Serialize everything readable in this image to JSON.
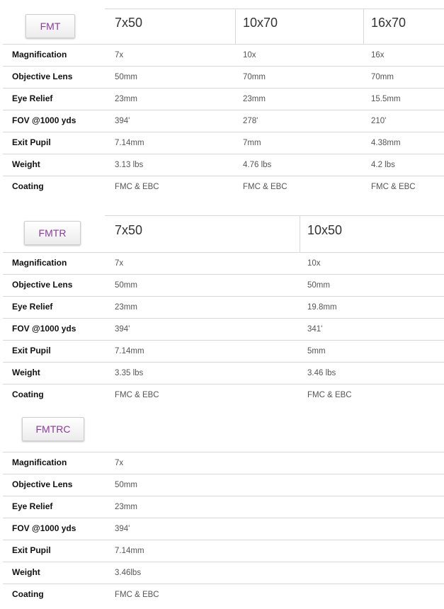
{
  "sections": [
    {
      "tab": "FMT",
      "models": [
        "7x50",
        "10x70",
        "16x70"
      ],
      "rows": [
        {
          "label": "Magnification",
          "values": [
            "7x",
            "10x",
            "16x"
          ]
        },
        {
          "label": "Objective Lens",
          "values": [
            "50mm",
            "70mm",
            "70mm"
          ]
        },
        {
          "label": "Eye Relief",
          "values": [
            "23mm",
            "23mm",
            "15.5mm"
          ]
        },
        {
          "label": "FOV @1000 yds",
          "values": [
            "394'",
            "278'",
            "210'"
          ]
        },
        {
          "label": "Exit Pupil",
          "values": [
            "7.14mm",
            "7mm",
            "4.38mm"
          ]
        },
        {
          "label": "Weight",
          "values": [
            "3.13 lbs",
            "4.76 lbs",
            "4.2 lbs"
          ]
        },
        {
          "label": "Coating",
          "values": [
            "FMC & EBC",
            "FMC & EBC",
            "FMC & EBC"
          ]
        }
      ]
    },
    {
      "tab": "FMTR",
      "models": [
        "7x50",
        "10x50"
      ],
      "rows": [
        {
          "label": "Magnification",
          "values": [
            "7x",
            "10x"
          ]
        },
        {
          "label": "Objective Lens",
          "values": [
            "50mm",
            "50mm"
          ]
        },
        {
          "label": "Eye Relief",
          "values": [
            "23mm",
            "19.8mm"
          ]
        },
        {
          "label": "FOV @1000 yds",
          "values": [
            "394'",
            "341'"
          ]
        },
        {
          "label": "Exit Pupil",
          "values": [
            "7.14mm",
            "5mm"
          ]
        },
        {
          "label": "Weight",
          "values": [
            "3.35 lbs",
            "3.46 lbs"
          ]
        },
        {
          "label": "Coating",
          "values": [
            "FMC & EBC",
            "FMC & EBC"
          ]
        }
      ]
    },
    {
      "tab": "FMTRC",
      "models": [],
      "rows": [
        {
          "label": "Magnification",
          "values": [
            "7x"
          ]
        },
        {
          "label": "Objective Lens",
          "values": [
            "50mm"
          ]
        },
        {
          "label": "Eye Relief",
          "values": [
            "23mm"
          ]
        },
        {
          "label": "FOV @1000 yds",
          "values": [
            "394'"
          ]
        },
        {
          "label": "Exit Pupil",
          "values": [
            "7.14mm"
          ]
        },
        {
          "label": "Weight",
          "values": [
            "3.46lbs"
          ]
        },
        {
          "label": "Coating",
          "values": [
            "FMC & EBC"
          ]
        }
      ]
    }
  ]
}
